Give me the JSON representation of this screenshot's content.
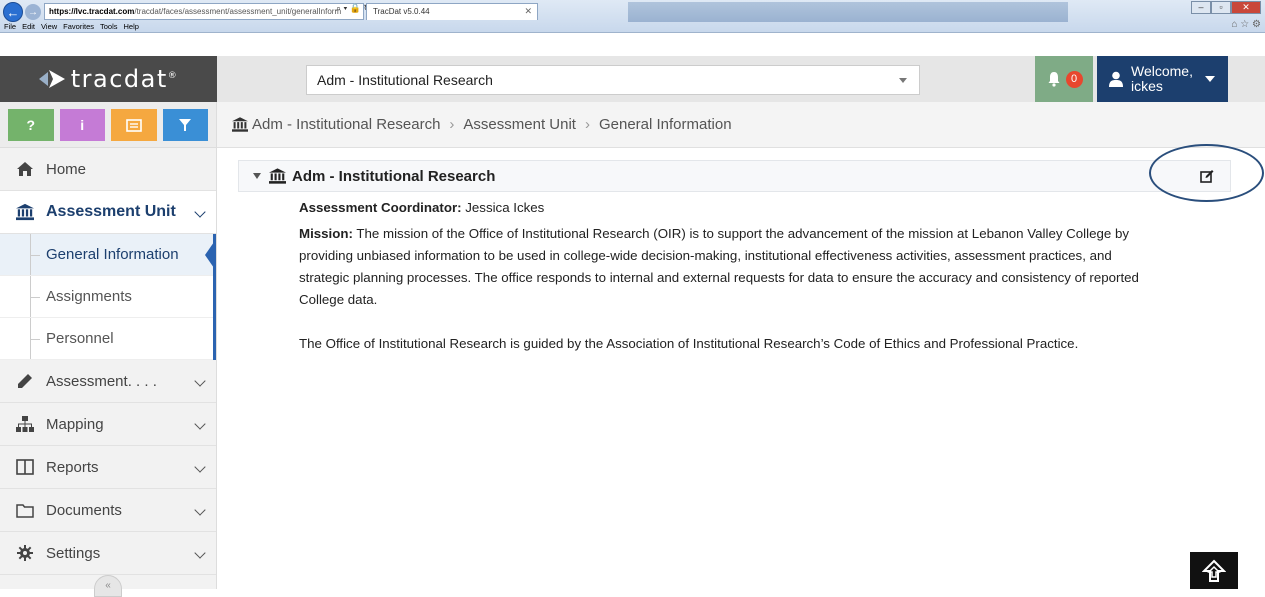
{
  "browser": {
    "url_host": "https://lvc.tracdat.com",
    "url_path": "/tracdat/faces/assessment/assessment_unit/generalInform",
    "tab_title": "TracDat v5.0.44",
    "menu": [
      "File",
      "Edit",
      "View",
      "Favorites",
      "Tools",
      "Help"
    ]
  },
  "header": {
    "brand": "tracdat",
    "brand_mark": "®",
    "unit_selector": "Adm - Institutional Research",
    "notification_count": "0",
    "welcome_line1": "Welcome,",
    "welcome_line2": "ickes"
  },
  "quick_buttons": {
    "help": "?",
    "info": "i"
  },
  "sidebar": {
    "home": "Home",
    "assessment_unit": "Assessment Unit",
    "sub_items": [
      "General Information",
      "Assignments",
      "Personnel"
    ],
    "assessment": "Assessment. . . .",
    "mapping": "Mapping",
    "reports": "Reports",
    "documents": "Documents",
    "settings": "Settings"
  },
  "breadcrumb": [
    "Adm - Institutional Research",
    "Assessment Unit",
    "General Information"
  ],
  "panel": {
    "title": "Adm - Institutional Research",
    "coordinator_label": "Assessment Coordinator:",
    "coordinator_value": "Jessica Ickes",
    "mission_label": "Mission:",
    "mission_text": "The mission of the Office of Institutional Research (OIR) is to support the advancement of the mission at Lebanon Valley College by providing unbiased information to be used in college-wide decision-making, institutional effectiveness activities, assessment practices, and strategic planning processes.  The office responds to internal and external requests for data to ensure the accuracy and consistency of reported College data.",
    "guide_text": "The Office of Institutional Research is guided by the Association of Institutional Research’s Code of Ethics and Professional Practice."
  },
  "colors": {
    "brand_bg": "#4a4a4a",
    "navy": "#1c3f6e",
    "notif_green": "#7fab86",
    "badge_red": "#e8472e"
  },
  "icons": [
    "back-arrow-icon",
    "forward-arrow-icon",
    "bell-icon",
    "user-icon",
    "question-icon",
    "info-icon",
    "notes-icon",
    "filter-icon",
    "home-icon",
    "institution-icon",
    "pencil-icon",
    "sitemap-icon",
    "reports-icon",
    "folder-icon",
    "gear-icon",
    "edit-icon",
    "scroll-top-icon"
  ]
}
